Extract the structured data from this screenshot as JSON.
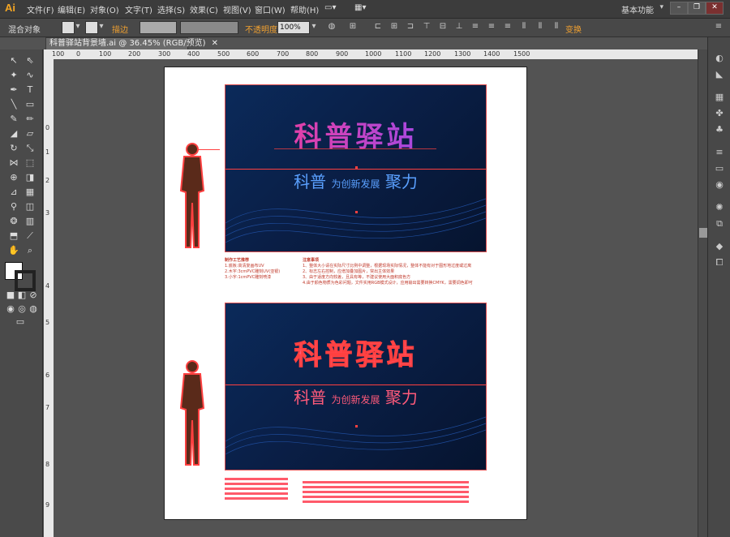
{
  "app": {
    "logo": "Ai",
    "workspace": "基本功能"
  },
  "menu": [
    "文件(F)",
    "编辑(E)",
    "对象(O)",
    "文字(T)",
    "选择(S)",
    "效果(C)",
    "视图(V)",
    "窗口(W)",
    "帮助(H)"
  ],
  "window_controls": [
    "–",
    "❐",
    "✕"
  ],
  "control_bar": {
    "selection": "混合对象",
    "stroke_label": "描边",
    "opacity_label": "不透明度",
    "opacity_value": "100%",
    "transform_label": "变换"
  },
  "document_tab": {
    "title": "科普驿站背景墙.ai @ 36.45% (RGB/预览)",
    "close": "✕"
  },
  "ruler_h": [
    "100",
    "0",
    "100",
    "200",
    "300",
    "400",
    "500",
    "600",
    "700",
    "800",
    "900",
    "1000",
    "1100",
    "1200",
    "1300",
    "1400",
    "1500"
  ],
  "ruler_v": [
    "0",
    "1",
    "2",
    "3",
    "4",
    "5",
    "6",
    "7",
    "8",
    "9"
  ],
  "design_top": {
    "title": "科普驿站",
    "subtitle_left": "科普",
    "subtitle_small": "为创新发展",
    "subtitle_right": "聚力"
  },
  "design_bottom": {
    "title": "科普驿站",
    "subtitle_left": "科普",
    "subtitle_small": "为创新发展",
    "subtitle_right": "聚力"
  },
  "notes_left": {
    "heading": "制作工艺推荐",
    "items": [
      "1.底板:高清复画布UV",
      "2.木字:3cmPVC雕刻UV(亚银)",
      "3.小字:1cmPVC雕刻喷漆"
    ]
  },
  "notes_right": {
    "heading": "注意事项",
    "items": [
      "1、整体大小请在实际尺寸比例中调整，根据现场实际情况，整体不能有对于图形地过度或过离",
      "2、标志左右控制，应增加叠加图片，突出主体效果",
      "3、由于适度方向较差，且具有等，不建议使用大面积底色方",
      "4.由于颜色物质为色彩问题，文件实用RGB模式设计，应用输出需要转换CMYK，需要调色即可"
    ]
  },
  "colors": {
    "accent_red": "#ff4040",
    "design_bg": "#0a1f47",
    "title_gradient_start": "#ff3b8a",
    "title_gradient_end": "#8a4dff"
  }
}
